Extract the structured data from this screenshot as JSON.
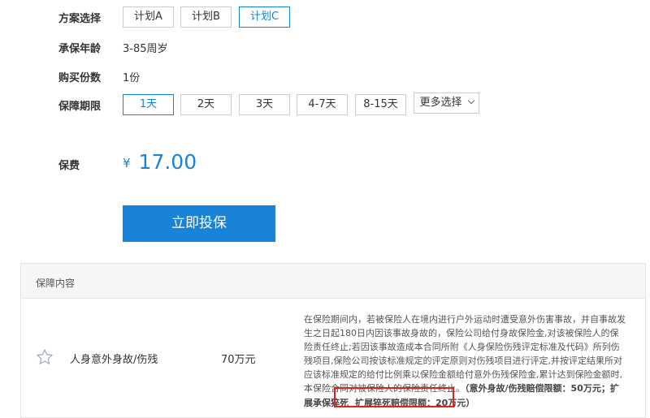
{
  "plan": {
    "label": "方案选择",
    "options": [
      "计划A",
      "计划B",
      "计划C"
    ],
    "selected": "计划C"
  },
  "age": {
    "label": "承保年龄",
    "value": "3-85周岁"
  },
  "copies": {
    "label": "购买份数",
    "value": "1份"
  },
  "period": {
    "label": "保障期限",
    "options": [
      "1天",
      "2天",
      "3天",
      "4-7天",
      "8-15天"
    ],
    "selected": "1天",
    "more": "更多选择"
  },
  "premium": {
    "label": "保费",
    "currency": "¥",
    "amount": "17.00"
  },
  "buy_button": "立即投保",
  "coverage": {
    "header": "保障内容",
    "items": [
      {
        "name": "人身意外身故/伤残",
        "amount": "70万元",
        "description": "在保险期间内，若被保险人在境内进行户外运动时遭受意外伤害事故，并自事故发生之日起180日内因该事故身故的，保险公司给付身故保险金,对该被保险人的保险责任终止;若因该事故造成本合同所附《人身保险伤残评定标准及代码》所列伤残项目,保险公司按该标准规定的评定原则对伤残项目进行评定,并按评定结果所对应该标准规定的给付比例乘以保险金额给付意外伤残保险金,累计达到保险金额时,本保险合同对被保险人的保险责任终止。",
        "limit_note": "（意外身故/伤残赔偿限额：50万元；扩展承保猝死",
        "limit_highlight": "扩展猝死赔偿限额：20万元",
        "limit_end": "）"
      }
    ]
  },
  "colors": {
    "accent": "#1883d7",
    "highlight_border": "#e0201b"
  }
}
